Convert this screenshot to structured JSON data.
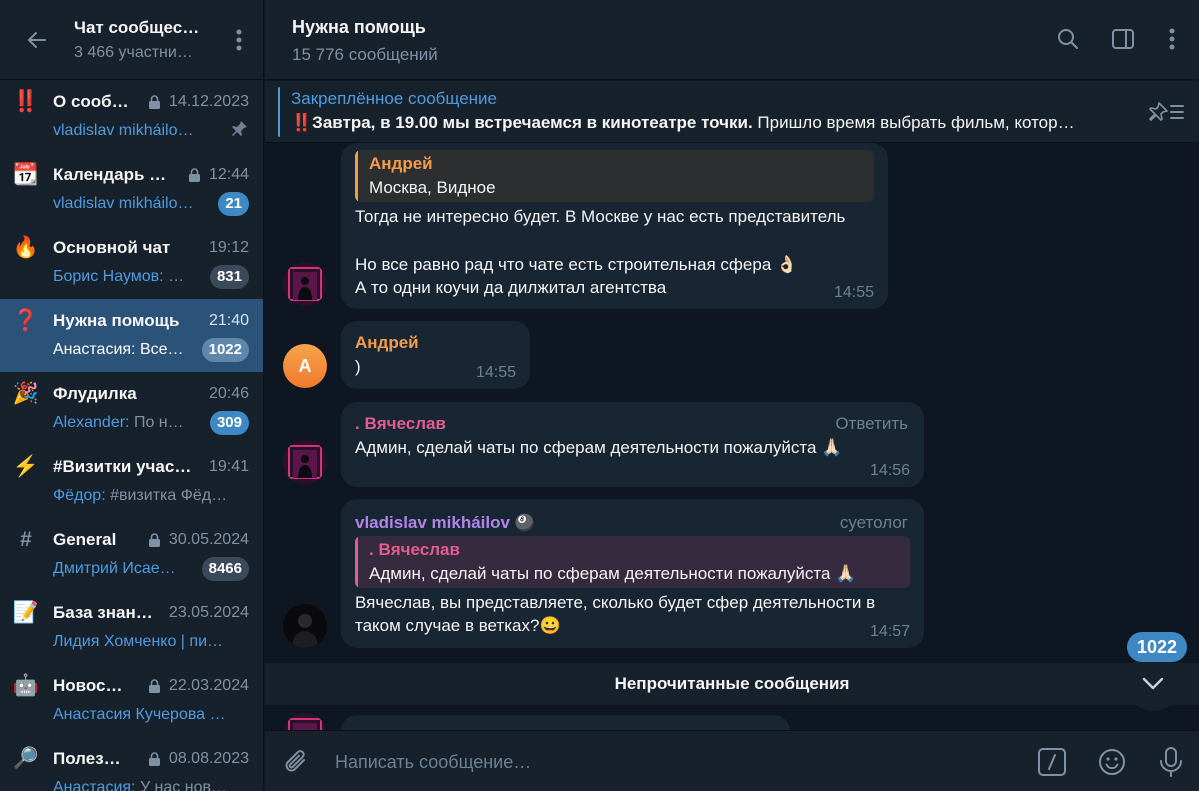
{
  "sidebar": {
    "title": "Чат сообщес…",
    "subtitle": "3 466 участни…",
    "topics": [
      {
        "icon": "‼️",
        "name": "О сооб…",
        "locked": true,
        "time": "14.12.2023",
        "preview": "vladislav mikháilo…",
        "pinned": true
      },
      {
        "icon": "📆",
        "name": "Календарь …",
        "locked": true,
        "time": "12:44",
        "preview": "vladislav mikháilo…",
        "badge": "21"
      },
      {
        "icon": "🔥",
        "name": "Основной чат",
        "time": "19:12",
        "preview_author": "Борис Наумов:",
        "preview": " …",
        "badge": "831"
      },
      {
        "icon": "❓",
        "name": "Нужна помощь",
        "time": "21:40",
        "preview_author": "Анастасия:",
        "preview": " Все…",
        "badge": "1022"
      },
      {
        "icon": "🎉",
        "name": "Флудилка",
        "time": "20:46",
        "preview_author": "Alexander:",
        "preview": " По н…",
        "badge": "309"
      },
      {
        "icon": "⚡",
        "name": "#Визитки учас…",
        "time": "19:41",
        "preview_author": "Фёдор:",
        "preview": " #визитка Фёд…"
      },
      {
        "icon": "#",
        "name": "General",
        "locked": true,
        "time": "30.05.2024",
        "preview": "Дмитрий Исае…",
        "badge": "8466"
      },
      {
        "icon": "📝",
        "name": "База знан…",
        "time": "23.05.2024",
        "preview": "Лидия Хомченко | пи…"
      },
      {
        "icon": "🤖",
        "name": "Новос…",
        "locked": true,
        "time": "22.03.2024",
        "preview": "Анастасия Кучерова …"
      },
      {
        "icon": "🔎",
        "name": "Полез…",
        "locked": true,
        "time": "08.08.2023",
        "preview_author": "Анастасия:",
        "preview": " У нас нов…"
      }
    ]
  },
  "header": {
    "title": "Нужна помощь",
    "subtitle": "15 776 сообщений"
  },
  "pinned": {
    "label": "Закреплённое сообщение",
    "bold": "‼️Завтра, в 19.00 мы встречаемся в кинотеатре точки.",
    "text": " Пришло время выбрать фильм, котор…"
  },
  "messages": {
    "m1": {
      "reply_author": "Андрей",
      "reply_text": "Москва, Видное",
      "line1": "Тогда не интересно будет. В Москве у нас есть представитель",
      "line2": "Но все равно рад что чате есть строительная сфера 👌🏻",
      "line3": "А то одни коучи да дилжитал агентства",
      "time": "14:55"
    },
    "m2": {
      "avatar_letter": "А",
      "author": "Андрей",
      "text": ")",
      "time": "14:55"
    },
    "m3": {
      "author": ". Вячеслав",
      "action": "Ответить",
      "text": "Админ, сделай чаты по сферам деятельности пожалуйста 🙏🏻",
      "time": "14:56"
    },
    "m4": {
      "author": "vladislav mikháilov",
      "author_emoji": "🎱",
      "role": "суетолог",
      "reply_author": ". Вячеслав",
      "reply_text": "Админ, сделай чаты по сферам деятельности пожалуйста 🙏🏻",
      "line1": "Вячеслав, вы представляете, сколько будет сфер деятельности в",
      "line2": "таком случае в ветках?😀",
      "time": "14:57"
    },
    "unread_label": "Непрочитанные сообщения",
    "unread_count": "1022"
  },
  "composer": {
    "placeholder": "Написать сообщение…"
  },
  "colors": {
    "accent": "#4f9be0",
    "andrey": "#f29d4b",
    "vyacheslav": "#e35d8f",
    "vladislav": "#b185e8"
  }
}
